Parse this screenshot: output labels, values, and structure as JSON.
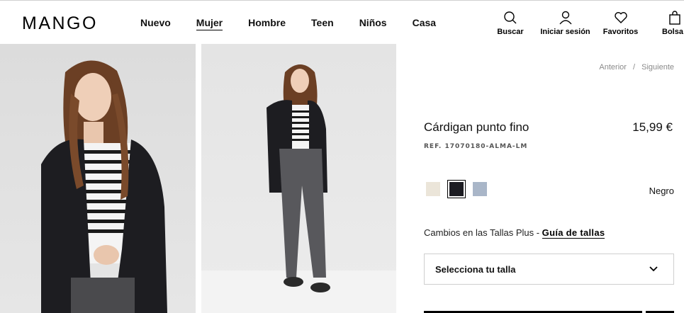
{
  "brand": {
    "logo": "MANGO"
  },
  "nav": {
    "items": [
      {
        "label": "Nuevo",
        "active": false
      },
      {
        "label": "Mujer",
        "active": true
      },
      {
        "label": "Hombre",
        "active": false
      },
      {
        "label": "Teen",
        "active": false
      },
      {
        "label": "Niños",
        "active": false
      },
      {
        "label": "Casa",
        "active": false
      }
    ]
  },
  "actions": {
    "search": {
      "label": "Buscar",
      "icon": "search-icon"
    },
    "login": {
      "label": "Iniciar sesión",
      "icon": "user-icon"
    },
    "favorites": {
      "label": "Favoritos",
      "icon": "heart-icon"
    },
    "bag": {
      "label": "Bolsa",
      "icon": "bag-icon"
    }
  },
  "pager": {
    "prev": "Anterior",
    "separator": "/",
    "next": "Siguiente"
  },
  "product": {
    "title": "Cárdigan punto fino",
    "price": "15,99 €",
    "ref": "REF. 17070180-ALMA-LM",
    "selected_color": "Negro",
    "colors": [
      {
        "name": "crudo",
        "hex": "#ebe5d9"
      },
      {
        "name": "Negro",
        "hex": "#1c1c22",
        "selected": true
      },
      {
        "name": "azul",
        "hex": "#a9b6c8"
      }
    ]
  },
  "sizes": {
    "text": "Cambios en las Tallas Plus - ",
    "guide_label": "Guía de tallas",
    "select_label": "Selecciona tu talla"
  }
}
